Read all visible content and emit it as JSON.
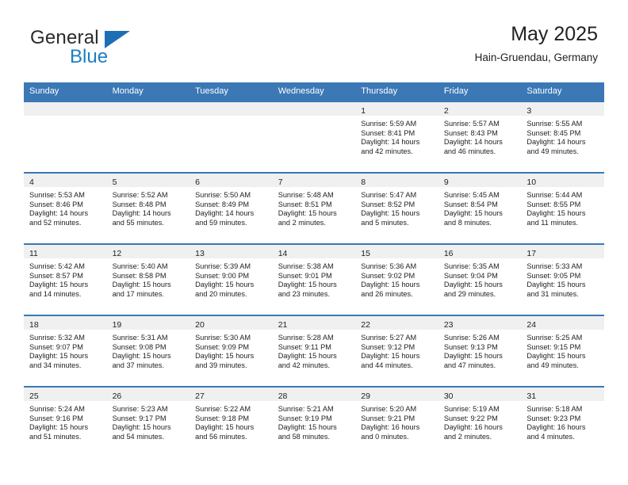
{
  "brand": {
    "name_top": "General",
    "name_bottom": "Blue",
    "accent_color": "#1d6fb5",
    "triangle_icon": "triangle-icon"
  },
  "header": {
    "title": "May 2025",
    "location": "Hain-Gruendau, Germany"
  },
  "colors": {
    "header_bar": "#3b78b5",
    "day_strip": "#f0f0f0",
    "text": "#222222",
    "logo_blue": "#1a7fc1"
  },
  "calendar": {
    "weekday_headers": [
      "Sunday",
      "Monday",
      "Tuesday",
      "Wednesday",
      "Thursday",
      "Friday",
      "Saturday"
    ],
    "weeks": [
      [
        {
          "day": "",
          "empty": true
        },
        {
          "day": "",
          "empty": true
        },
        {
          "day": "",
          "empty": true
        },
        {
          "day": "",
          "empty": true
        },
        {
          "day": "1",
          "sunrise": "Sunrise: 5:59 AM",
          "sunset": "Sunset: 8:41 PM",
          "daylight1": "Daylight: 14 hours",
          "daylight2": "and 42 minutes."
        },
        {
          "day": "2",
          "sunrise": "Sunrise: 5:57 AM",
          "sunset": "Sunset: 8:43 PM",
          "daylight1": "Daylight: 14 hours",
          "daylight2": "and 46 minutes."
        },
        {
          "day": "3",
          "sunrise": "Sunrise: 5:55 AM",
          "sunset": "Sunset: 8:45 PM",
          "daylight1": "Daylight: 14 hours",
          "daylight2": "and 49 minutes."
        }
      ],
      [
        {
          "day": "4",
          "sunrise": "Sunrise: 5:53 AM",
          "sunset": "Sunset: 8:46 PM",
          "daylight1": "Daylight: 14 hours",
          "daylight2": "and 52 minutes."
        },
        {
          "day": "5",
          "sunrise": "Sunrise: 5:52 AM",
          "sunset": "Sunset: 8:48 PM",
          "daylight1": "Daylight: 14 hours",
          "daylight2": "and 55 minutes."
        },
        {
          "day": "6",
          "sunrise": "Sunrise: 5:50 AM",
          "sunset": "Sunset: 8:49 PM",
          "daylight1": "Daylight: 14 hours",
          "daylight2": "and 59 minutes."
        },
        {
          "day": "7",
          "sunrise": "Sunrise: 5:48 AM",
          "sunset": "Sunset: 8:51 PM",
          "daylight1": "Daylight: 15 hours",
          "daylight2": "and 2 minutes."
        },
        {
          "day": "8",
          "sunrise": "Sunrise: 5:47 AM",
          "sunset": "Sunset: 8:52 PM",
          "daylight1": "Daylight: 15 hours",
          "daylight2": "and 5 minutes."
        },
        {
          "day": "9",
          "sunrise": "Sunrise: 5:45 AM",
          "sunset": "Sunset: 8:54 PM",
          "daylight1": "Daylight: 15 hours",
          "daylight2": "and 8 minutes."
        },
        {
          "day": "10",
          "sunrise": "Sunrise: 5:44 AM",
          "sunset": "Sunset: 8:55 PM",
          "daylight1": "Daylight: 15 hours",
          "daylight2": "and 11 minutes."
        }
      ],
      [
        {
          "day": "11",
          "sunrise": "Sunrise: 5:42 AM",
          "sunset": "Sunset: 8:57 PM",
          "daylight1": "Daylight: 15 hours",
          "daylight2": "and 14 minutes."
        },
        {
          "day": "12",
          "sunrise": "Sunrise: 5:40 AM",
          "sunset": "Sunset: 8:58 PM",
          "daylight1": "Daylight: 15 hours",
          "daylight2": "and 17 minutes."
        },
        {
          "day": "13",
          "sunrise": "Sunrise: 5:39 AM",
          "sunset": "Sunset: 9:00 PM",
          "daylight1": "Daylight: 15 hours",
          "daylight2": "and 20 minutes."
        },
        {
          "day": "14",
          "sunrise": "Sunrise: 5:38 AM",
          "sunset": "Sunset: 9:01 PM",
          "daylight1": "Daylight: 15 hours",
          "daylight2": "and 23 minutes."
        },
        {
          "day": "15",
          "sunrise": "Sunrise: 5:36 AM",
          "sunset": "Sunset: 9:02 PM",
          "daylight1": "Daylight: 15 hours",
          "daylight2": "and 26 minutes."
        },
        {
          "day": "16",
          "sunrise": "Sunrise: 5:35 AM",
          "sunset": "Sunset: 9:04 PM",
          "daylight1": "Daylight: 15 hours",
          "daylight2": "and 29 minutes."
        },
        {
          "day": "17",
          "sunrise": "Sunrise: 5:33 AM",
          "sunset": "Sunset: 9:05 PM",
          "daylight1": "Daylight: 15 hours",
          "daylight2": "and 31 minutes."
        }
      ],
      [
        {
          "day": "18",
          "sunrise": "Sunrise: 5:32 AM",
          "sunset": "Sunset: 9:07 PM",
          "daylight1": "Daylight: 15 hours",
          "daylight2": "and 34 minutes."
        },
        {
          "day": "19",
          "sunrise": "Sunrise: 5:31 AM",
          "sunset": "Sunset: 9:08 PM",
          "daylight1": "Daylight: 15 hours",
          "daylight2": "and 37 minutes."
        },
        {
          "day": "20",
          "sunrise": "Sunrise: 5:30 AM",
          "sunset": "Sunset: 9:09 PM",
          "daylight1": "Daylight: 15 hours",
          "daylight2": "and 39 minutes."
        },
        {
          "day": "21",
          "sunrise": "Sunrise: 5:28 AM",
          "sunset": "Sunset: 9:11 PM",
          "daylight1": "Daylight: 15 hours",
          "daylight2": "and 42 minutes."
        },
        {
          "day": "22",
          "sunrise": "Sunrise: 5:27 AM",
          "sunset": "Sunset: 9:12 PM",
          "daylight1": "Daylight: 15 hours",
          "daylight2": "and 44 minutes."
        },
        {
          "day": "23",
          "sunrise": "Sunrise: 5:26 AM",
          "sunset": "Sunset: 9:13 PM",
          "daylight1": "Daylight: 15 hours",
          "daylight2": "and 47 minutes."
        },
        {
          "day": "24",
          "sunrise": "Sunrise: 5:25 AM",
          "sunset": "Sunset: 9:15 PM",
          "daylight1": "Daylight: 15 hours",
          "daylight2": "and 49 minutes."
        }
      ],
      [
        {
          "day": "25",
          "sunrise": "Sunrise: 5:24 AM",
          "sunset": "Sunset: 9:16 PM",
          "daylight1": "Daylight: 15 hours",
          "daylight2": "and 51 minutes."
        },
        {
          "day": "26",
          "sunrise": "Sunrise: 5:23 AM",
          "sunset": "Sunset: 9:17 PM",
          "daylight1": "Daylight: 15 hours",
          "daylight2": "and 54 minutes."
        },
        {
          "day": "27",
          "sunrise": "Sunrise: 5:22 AM",
          "sunset": "Sunset: 9:18 PM",
          "daylight1": "Daylight: 15 hours",
          "daylight2": "and 56 minutes."
        },
        {
          "day": "28",
          "sunrise": "Sunrise: 5:21 AM",
          "sunset": "Sunset: 9:19 PM",
          "daylight1": "Daylight: 15 hours",
          "daylight2": "and 58 minutes."
        },
        {
          "day": "29",
          "sunrise": "Sunrise: 5:20 AM",
          "sunset": "Sunset: 9:21 PM",
          "daylight1": "Daylight: 16 hours",
          "daylight2": "and 0 minutes."
        },
        {
          "day": "30",
          "sunrise": "Sunrise: 5:19 AM",
          "sunset": "Sunset: 9:22 PM",
          "daylight1": "Daylight: 16 hours",
          "daylight2": "and 2 minutes."
        },
        {
          "day": "31",
          "sunrise": "Sunrise: 5:18 AM",
          "sunset": "Sunset: 9:23 PM",
          "daylight1": "Daylight: 16 hours",
          "daylight2": "and 4 minutes."
        }
      ]
    ]
  }
}
